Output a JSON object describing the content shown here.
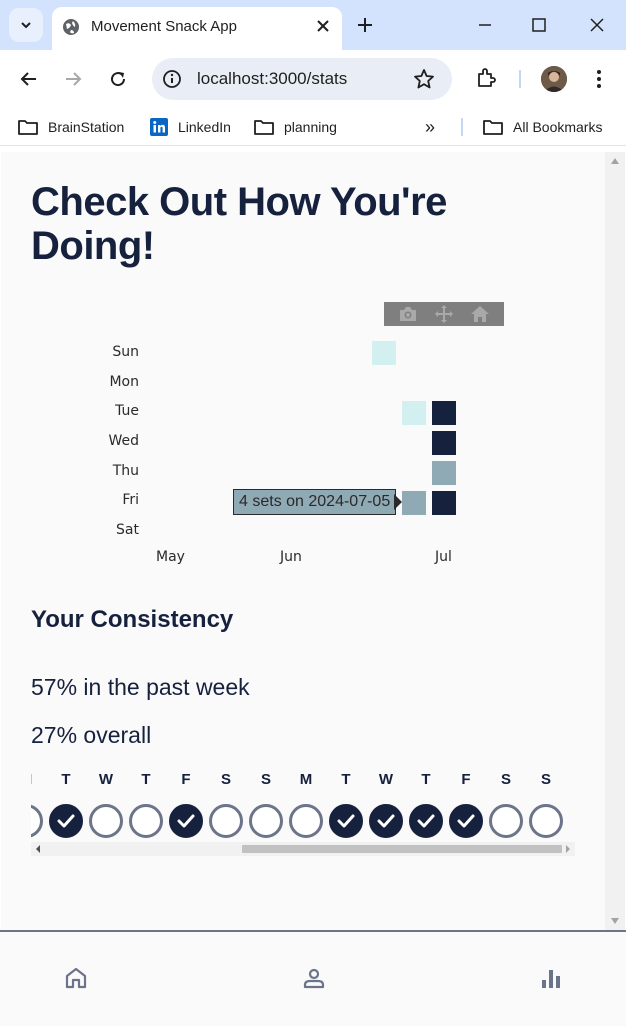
{
  "browser": {
    "tab_title": "Movement Snack App",
    "url": "localhost:3000/stats",
    "bookmarks": [
      "BrainStation",
      "LinkedIn",
      "planning"
    ],
    "all_bookmarks": "All Bookmarks",
    "more_bookmarks": "»"
  },
  "page": {
    "title": "Check Out How You're Doing!"
  },
  "heatmap": {
    "day_labels": [
      "Sun",
      "Mon",
      "Tue",
      "Wed",
      "Thu",
      "Fri",
      "Sat"
    ],
    "month_labels": [
      "May",
      "Jun",
      "Jul"
    ],
    "tooltip": "4 sets on 2024-07-05",
    "colors": {
      "light": "#d2f0f0",
      "mid": "#8fa9b5",
      "dark": "#16213d"
    },
    "cells": [
      {
        "date": "2024-06-23",
        "level": "light"
      },
      {
        "date": "2024-07-02",
        "level": "light"
      },
      {
        "date": "2024-07-05",
        "level": "mid"
      },
      {
        "date": "2024-07-09",
        "level": "dark"
      },
      {
        "date": "2024-07-10",
        "level": "dark"
      },
      {
        "date": "2024-07-11",
        "level": "mid"
      },
      {
        "date": "2024-07-12",
        "level": "dark"
      }
    ]
  },
  "consistency": {
    "title": "Your Consistency",
    "past_week": "57% in the past week",
    "overall": "27% overall",
    "days": [
      {
        "letter": "M",
        "done": false
      },
      {
        "letter": "T",
        "done": true
      },
      {
        "letter": "W",
        "done": false
      },
      {
        "letter": "T",
        "done": false
      },
      {
        "letter": "F",
        "done": true
      },
      {
        "letter": "S",
        "done": false
      },
      {
        "letter": "S",
        "done": false
      },
      {
        "letter": "M",
        "done": false
      },
      {
        "letter": "T",
        "done": true
      },
      {
        "letter": "W",
        "done": true
      },
      {
        "letter": "T",
        "done": true
      },
      {
        "letter": "F",
        "done": true
      },
      {
        "letter": "S",
        "done": false
      },
      {
        "letter": "S",
        "done": false
      }
    ]
  },
  "bottom_nav": [
    "home-icon",
    "profile-icon",
    "stats-icon"
  ]
}
